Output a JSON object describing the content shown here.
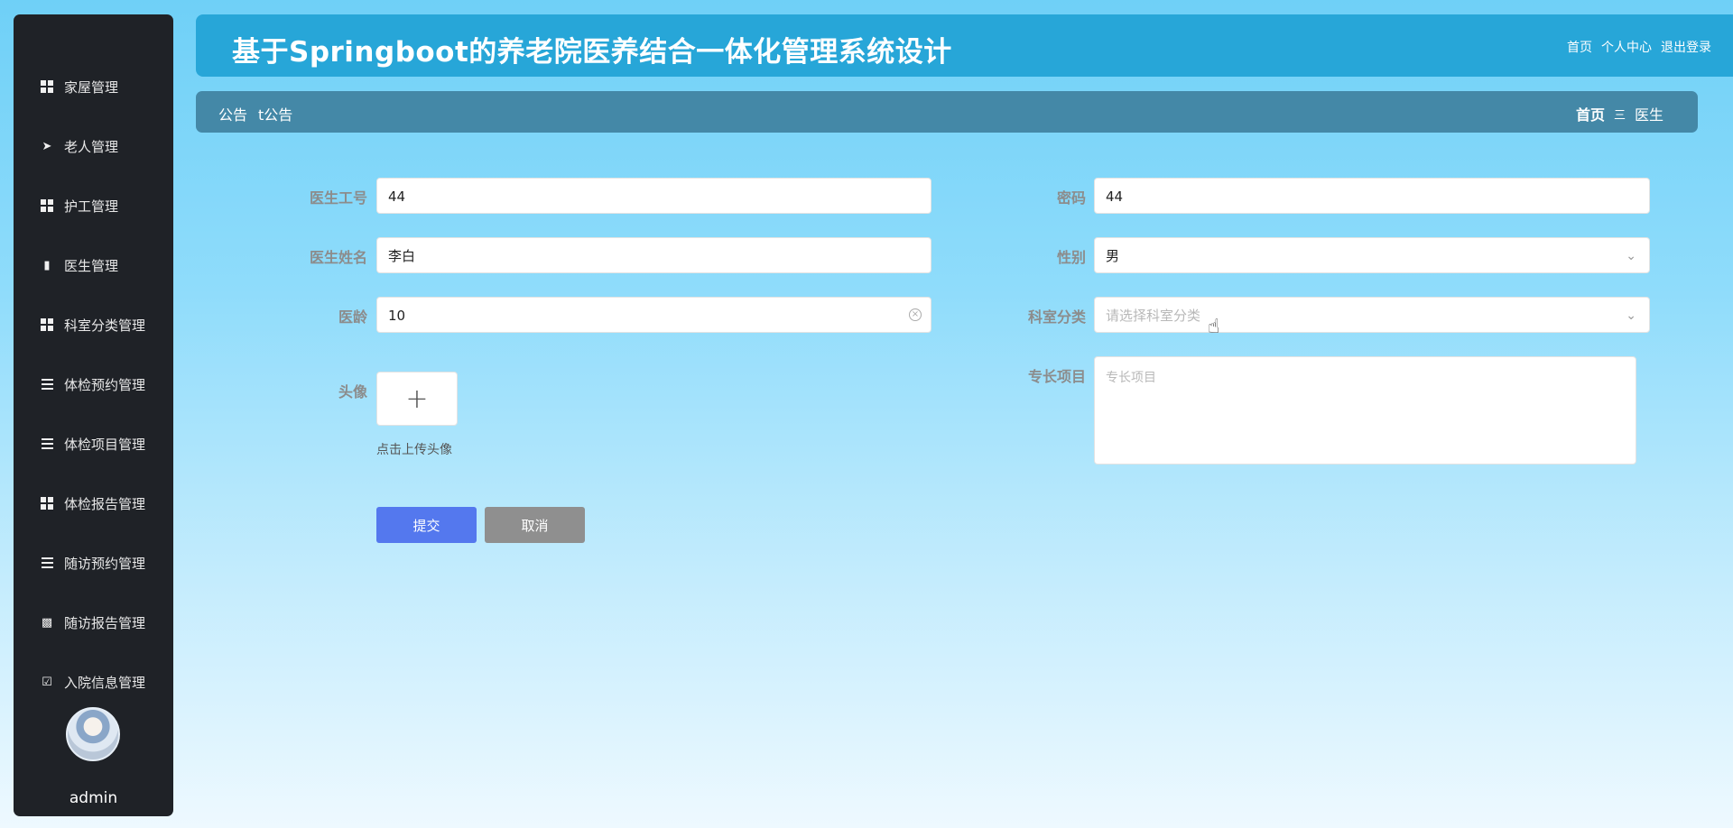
{
  "header": {
    "title": "基于Springboot的养老院医养结合一体化管理系统设计",
    "links": [
      "首页",
      "个人中心",
      "退出登录"
    ]
  },
  "sidebar": {
    "items": [
      {
        "label": "家屋管理",
        "icon": "grid-icon"
      },
      {
        "label": "老人管理",
        "icon": "send-icon"
      },
      {
        "label": "护工管理",
        "icon": "grid-icon"
      },
      {
        "label": "医生管理",
        "icon": "brush-icon"
      },
      {
        "label": "科室分类管理",
        "icon": "grid-icon"
      },
      {
        "label": "体检预约管理",
        "icon": "sliders-icon"
      },
      {
        "label": "体检项目管理",
        "icon": "list-icon"
      },
      {
        "label": "体检报告管理",
        "icon": "grid-icon"
      },
      {
        "label": "随访预约管理",
        "icon": "list-icon"
      },
      {
        "label": "随访报告管理",
        "icon": "monitor-icon"
      },
      {
        "label": "入院信息管理",
        "icon": "clipboard-icon"
      }
    ],
    "username": "admin"
  },
  "subbar": {
    "notice_label": "公告",
    "notice_text": "t公告",
    "breadcrumb_home": "首页",
    "breadcrumb_sep": "三",
    "breadcrumb_current": "医生"
  },
  "form": {
    "doctor_id": {
      "label": "医生工号",
      "value": "44"
    },
    "password": {
      "label": "密码",
      "value": "44"
    },
    "doctor_name": {
      "label": "医生姓名",
      "value": "李白"
    },
    "gender": {
      "label": "性别",
      "value": "男"
    },
    "experience": {
      "label": "医龄",
      "value": "10"
    },
    "department": {
      "label": "科室分类",
      "placeholder": "请选择科室分类"
    },
    "avatar": {
      "label": "头像",
      "tip": "点击上传头像"
    },
    "specialty": {
      "label": "专长项目",
      "placeholder": "专长项目"
    },
    "submit_label": "提交",
    "cancel_label": "取消"
  }
}
